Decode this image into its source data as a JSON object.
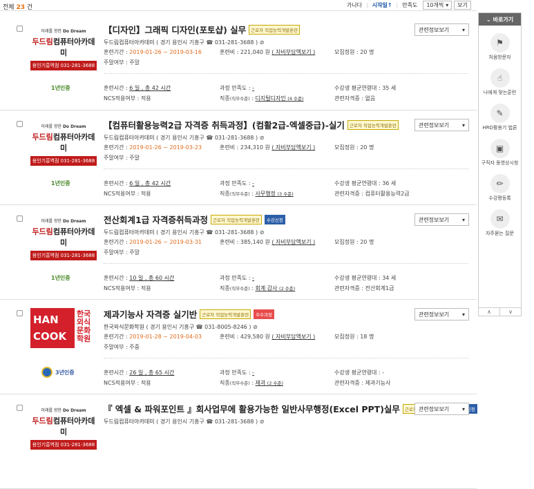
{
  "header": {
    "total_prefix": "전체",
    "total_count": "23",
    "total_suffix": "건",
    "sort_options": [
      "가나다",
      "시작일↑",
      "만족도"
    ],
    "page_size": "10개씩",
    "view_button": "보기"
  },
  "sidebar": {
    "title": "바로가기",
    "items": [
      {
        "label": "처음방문자",
        "icon": "flag-icon"
      },
      {
        "label": "나에게 맞는훈련",
        "icon": "hand-icon"
      },
      {
        "label": "HRD활용기 법론",
        "icon": "palette-icon"
      },
      {
        "label": "구직자 동영상시청",
        "icon": "video-icon"
      },
      {
        "label": "수강평등록",
        "icon": "pencil-icon"
      },
      {
        "label": "자주묻는 질문",
        "icon": "chat-icon"
      }
    ],
    "prev": "∧",
    "next": "∨"
  },
  "courses": [
    {
      "title": "【디자인】그래픽 디자인(포토샵) 실무",
      "tag": "근로자 직업능력개발훈련",
      "extra_tag": "",
      "logo": "dodream",
      "org": "두드림컴퓨터아카데미",
      "org_loc": "( 경기 용인시 기흥구 ☎ 031-281-3688 )",
      "period_label": "훈련기간 :",
      "period": "2019-01-26 ~ 2019-03-16",
      "fee": "훈련비 : 221,040 원",
      "fee_link": "( 자비부담액보기 )",
      "capacity": "모집정원 : 20 명",
      "schedule": "주말여부 : 주말",
      "cert": "1년인증",
      "hours_label": "훈련시간 :",
      "hours": "6 일 , 총 42 시간",
      "satisfaction_label": "과정 만족도 :",
      "satisfaction": "-",
      "age": "수강생 평균연령대 : 35 세",
      "ncs": "NCS적용여부 : 적용",
      "job_label": "직종",
      "job_sub": "(직무수준)",
      "job": "디지털디자인",
      "job_level": "(4 수준)",
      "license": "관련자격증 : 없음",
      "related": "관련정보보기"
    },
    {
      "title": "【컴퓨터활용능력2급 자격증 취득과정】(컴활2급-엑셀중급)-실기",
      "tag": "근로자 직업능력개발훈련",
      "extra_tag": "",
      "logo": "dodream",
      "org": "두드림컴퓨터아카데미",
      "org_loc": "( 경기 용인시 기흥구 ☎ 031-281-3688 )",
      "period_label": "훈련기간 :",
      "period": "2019-01-26 ~ 2019-03-23",
      "fee": "훈련비 : 234,310 원",
      "fee_link": "( 자비부담액보기 )",
      "capacity": "모집정원 : 20 명",
      "schedule": "주말여부 : 주말",
      "cert": "1년인증",
      "hours_label": "훈련시간 :",
      "hours": "6 일 , 총 42 시간",
      "satisfaction_label": "과정 만족도 :",
      "satisfaction": "-",
      "age": "수강생 평균연령대 : 36 세",
      "ncs": "NCS적용여부 : 적용",
      "job_label": "직종",
      "job_sub": "(직무수준)",
      "job": "사무행정",
      "job_level": "(3 수준)",
      "license": "관련자격증 : 컴퓨터활용능력2급",
      "related": "관련정보보기"
    },
    {
      "title": "전산회계1급 자격증취득과정",
      "tag": "근로자 직업능력개발훈련",
      "extra_tag": "수강신청",
      "extra_type": "blue",
      "logo": "dodream",
      "org": "두드림컴퓨터아카데미",
      "org_loc": "( 경기 용인시 기흥구 ☎ 031-281-3688 )",
      "period_label": "훈련기간 :",
      "period": "2019-01-26 ~ 2019-03-31",
      "fee": "훈련비 : 385,140 원",
      "fee_link": "( 자비부담액보기 )",
      "capacity": "모집정원 : 20 명",
      "schedule": "주말여부 : 주말",
      "cert": "1년인증",
      "hours_label": "훈련시간 :",
      "hours": "10 일 , 총 60 시간",
      "satisfaction_label": "과정 만족도 :",
      "satisfaction": "-",
      "age": "수강생 평균연령대 : 34 세",
      "ncs": "NCS적용여부 : 적용",
      "job_label": "직종",
      "job_sub": "(직무수준)",
      "job": "회계 감사",
      "job_level": "(2 수준)",
      "license": "관련자격증 : 전산회계1급",
      "related": "관련정보보기"
    },
    {
      "title": "제과기능사 자격증 실기반",
      "tag": "근로자 직업능력개발훈련",
      "extra_tag": "우수과정",
      "extra_type": "red",
      "logo": "hancook",
      "org": "한국외식문화학원",
      "org_loc": "( 경기 용인시 기흥구 ☎ 031-8005-8246 )",
      "period_label": "훈련기간 :",
      "period": "2019-01-28 ~ 2019-04-03",
      "fee": "훈련비 : 429,580 원",
      "fee_link": "( 자비부담액보기 )",
      "capacity": "모집정원 : 18 명",
      "schedule": "주말여부 : 주중",
      "cert": "3년인증",
      "hours_label": "훈련시간 :",
      "hours": "26 일 , 총 65 시간",
      "satisfaction_label": "과정 만족도 :",
      "satisfaction": "-",
      "age": "수강생 평균연령대 : -",
      "ncs": "NCS적용여부 : 적용",
      "job_label": "직종",
      "job_sub": "(직무수준)",
      "job": "제과",
      "job_level": "(2 수준)",
      "license": "관련자격증 : 제과기능사",
      "related": "관련정보보기"
    },
    {
      "title": "『 엑셀 & 파워포인트 』회사업무에 활용가능한 일반사무행정(Excel PPT)실무",
      "tag": "근로자 직업능력개발훈련",
      "extra_tag": "수강신청",
      "extra_type": "blue",
      "logo": "dodream",
      "org": "두드림컴퓨터아카데미",
      "org_loc": "( 경기 용인시 기흥구 ☎ 031-281-3688 )",
      "related": "관련정보보기"
    }
  ],
  "logos": {
    "dodream": {
      "line1": "미래를 향한",
      "brand_en": "Do Dream",
      "brand_red": "두드림",
      "brand_rest": "컴퓨터아카데미",
      "phone": "용인기흥역점 031-281-3688"
    },
    "hancook": {
      "line1": "HAN",
      "line2": "COOK",
      "kr1": "한국",
      "kr2": "외식",
      "kr3": "문화",
      "kr4": "학원"
    }
  }
}
